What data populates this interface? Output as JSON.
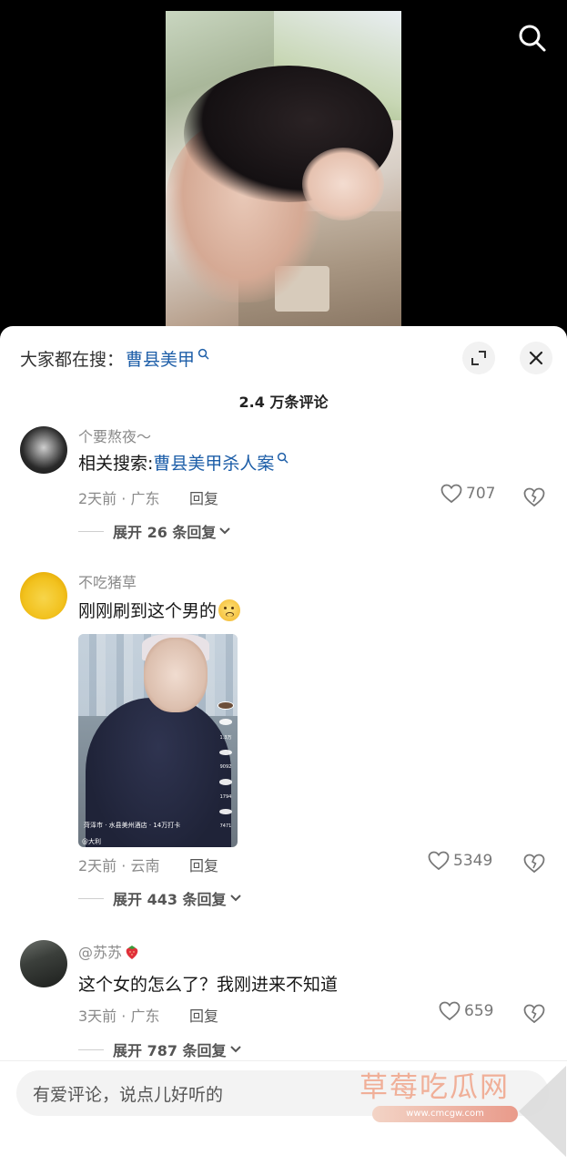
{
  "header": {
    "suggest_prefix": "大家都在搜：",
    "suggest_term": "曹县美甲"
  },
  "comments_title": "2.4 万条评论",
  "comments": [
    {
      "username": "个要熬夜～",
      "text_prefix": "相关搜索:",
      "text_link": "曹县美甲杀人案",
      "time_location": "2天前 · 广东",
      "reply_label": "回复",
      "likes": "707",
      "expand_label": "展开 26 条回复"
    },
    {
      "username": "不吃猪草",
      "text": "刚刚刷到这个男的",
      "emoji": "worried-face-emoji",
      "thumbnail": {
        "likes": "1.3万",
        "comments": "9092",
        "favorites": "1794",
        "shares": "7471",
        "location": "菏泽市 · 水县美州酒店 · 14万打卡",
        "author": "@大利"
      },
      "time_location": "2天前 · 云南",
      "reply_label": "回复",
      "likes": "5349",
      "expand_label": "展开 443 条回复"
    },
    {
      "username": "@苏苏",
      "text": "这个女的怎么了？我刚进来不知道",
      "time_location": "3天前 · 广东",
      "reply_label": "回复",
      "likes": "659",
      "expand_label": "展开 787 条回复"
    }
  ],
  "input": {
    "placeholder": "有爱评论，说点儿好听的"
  },
  "watermark": {
    "title": "草莓吃瓜网",
    "url": "www.cmcgw.com"
  },
  "colors": {
    "link": "#1d5ea8",
    "meta_gray": "#8a8a8a",
    "sheet_bg": "#ffffff",
    "video_bg": "#000000"
  }
}
